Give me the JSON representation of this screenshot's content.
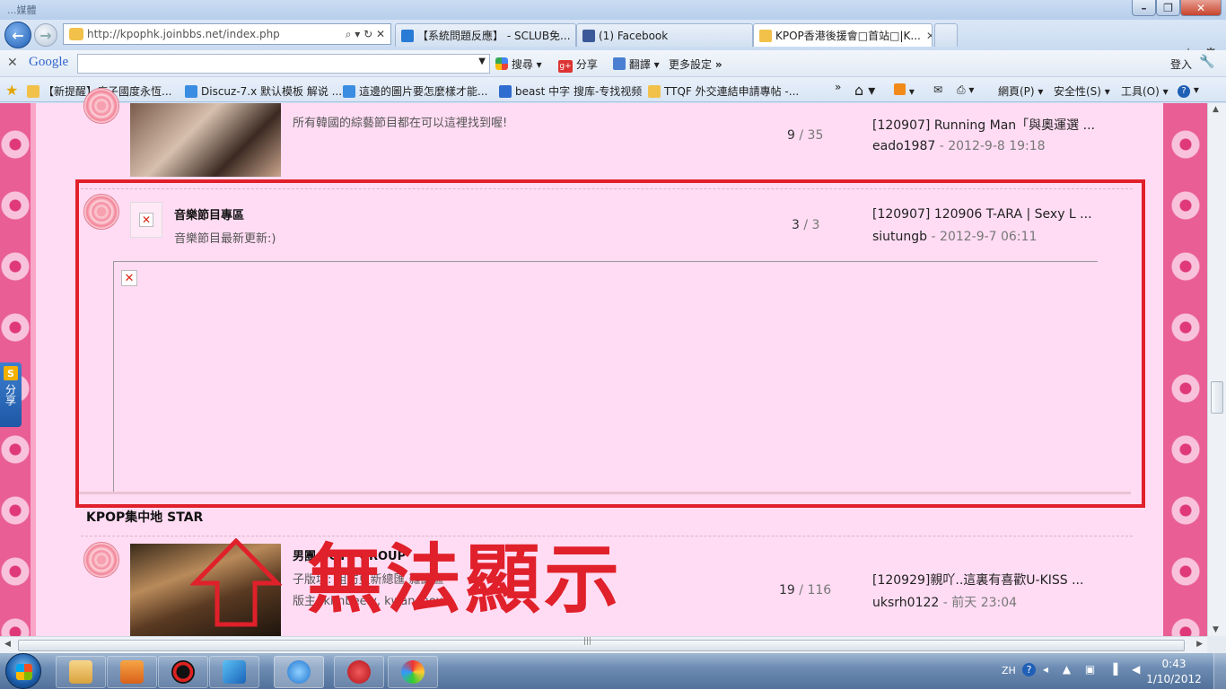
{
  "window": {
    "title": "...媒體"
  },
  "nav": {
    "url": "http://kpophk.joinbbs.net/index.php",
    "url_controls": "⌕ ▾ ↻ ✕",
    "tabs": [
      {
        "label": "【系統問題反應】 - SCLUB免...",
        "active": false
      },
      {
        "label": "(1) Facebook",
        "active": false
      },
      {
        "label": "KPOP香港後援會□首站□|K...",
        "active": true
      }
    ]
  },
  "google_toolbar": {
    "logo": "Google",
    "search_value": "",
    "search_label": "搜尋",
    "share_label": "分享",
    "translate_label": "翻譯",
    "settings_label": "更多設定",
    "login_label": "登入"
  },
  "favorites": {
    "items": [
      {
        "label": "【新提醒】瘋子國度永恆..."
      },
      {
        "label": "Discuz-7.x 默认模板 解说 ..."
      },
      {
        "label": "這邊的圖片要怎麼樣才能..."
      },
      {
        "label": "beast 中字 搜库-专找视频"
      },
      {
        "label": "TTQF 外交連結申請專帖 -..."
      }
    ],
    "more": "»"
  },
  "commands": {
    "page": "網頁(P)",
    "safety": "安全性(S)",
    "tools": "工具(O)",
    "help": "?"
  },
  "forum": {
    "rows": [
      {
        "name": "",
        "desc": "所有韓國的綜藝節目都在可以這裡找到喔!",
        "threads": "9",
        "posts": "35",
        "last_title": "[120907] Running Man「與奧運選 ...",
        "last_by": "eado1987",
        "last_time": "2012-9-8 19:18"
      },
      {
        "name": "音樂節目專區",
        "desc": "音樂節目最新更新:)",
        "threads": "3",
        "posts": "3",
        "last_title": "[120907] 120906 T-ARA | Sexy L ...",
        "last_by": "siutungb",
        "last_time": "2012-9-7 06:11"
      },
      {
        "name": "男團 BOYS GROUP",
        "desc": "子版塊: 組訪更新總匯  雜誌區",
        "moderator": "版主: kimbeely, kwanchoxd",
        "threads": "19",
        "posts": "116",
        "last_title": "[120929]親吖..這裏有喜歡U-KISS ...",
        "last_by": "uksrh0122",
        "last_time": "前天 23:04"
      }
    ],
    "section_title": "KPOP集中地 STAR",
    "separator": " / ",
    "dash": " - "
  },
  "annotation": {
    "text": "無法顯示",
    "color": "#e0202a"
  },
  "share_widget": {
    "badge": "S",
    "label": "分享"
  },
  "taskbar": {
    "lang": "ZH",
    "time": "0:43",
    "date": "1/10/2012"
  }
}
